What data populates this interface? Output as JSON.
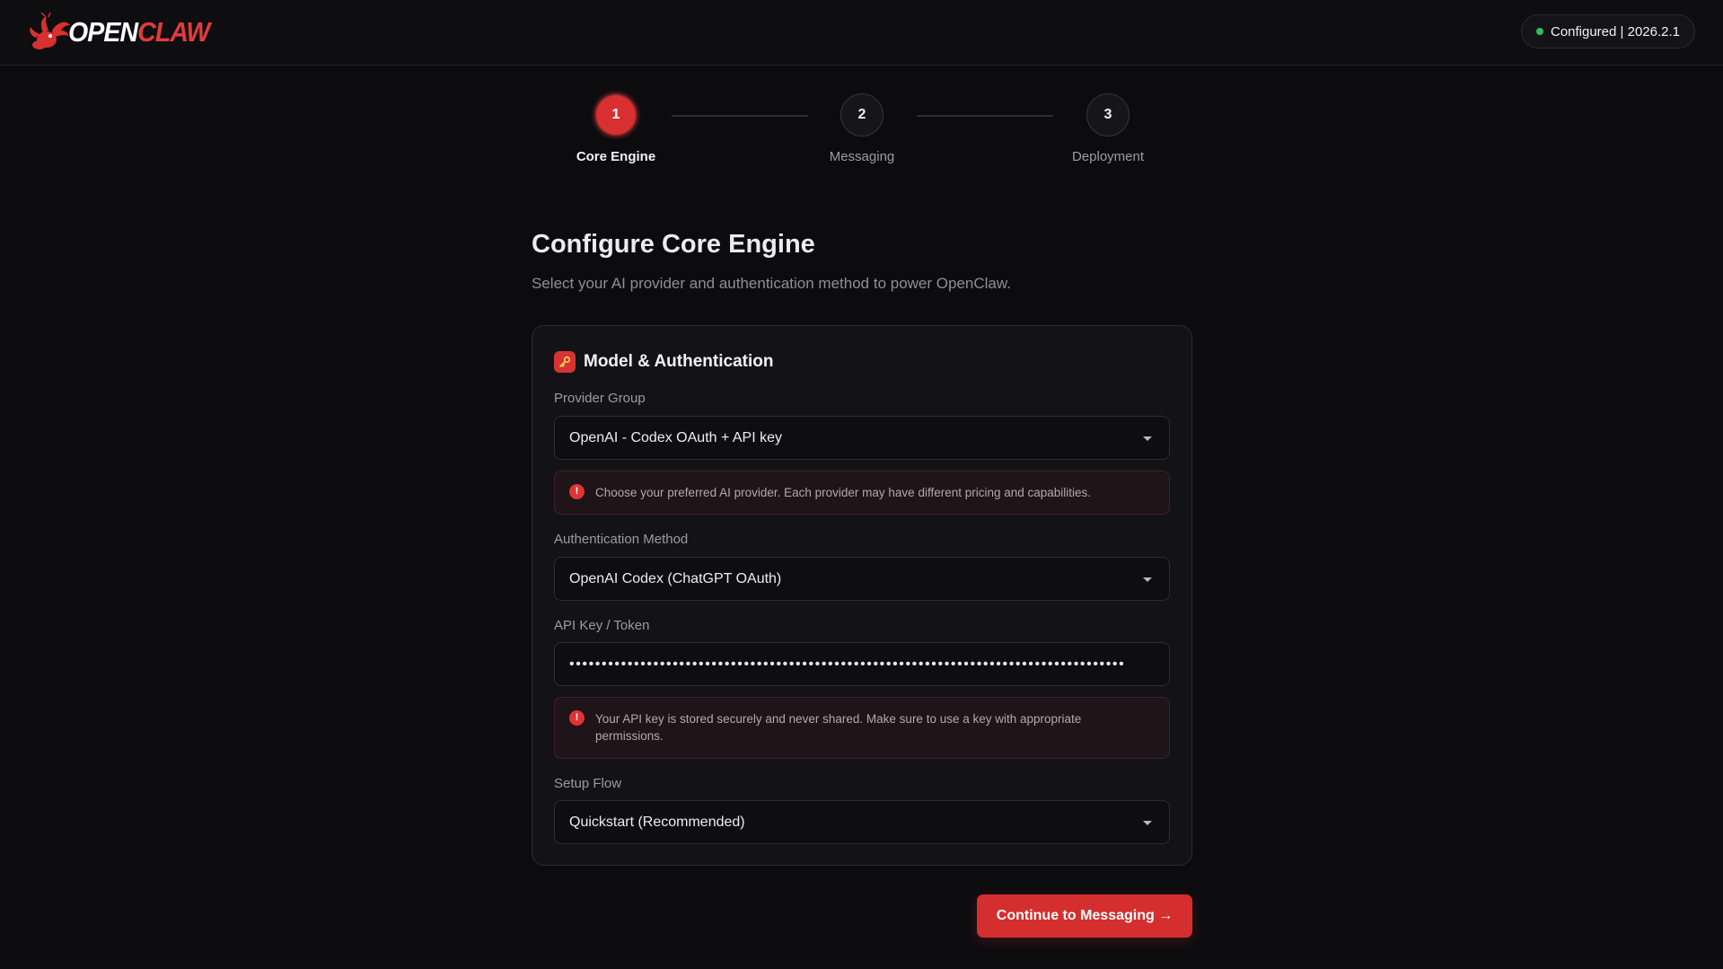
{
  "header": {
    "logo_open": "OPEN",
    "logo_claw": "CLAW",
    "status_text": "Configured | 2026.2.1",
    "status_color": "#2fbf5a"
  },
  "stepper": {
    "steps": [
      {
        "number": "1",
        "label": "Core Engine",
        "active": true
      },
      {
        "number": "2",
        "label": "Messaging",
        "active": false
      },
      {
        "number": "3",
        "label": "Deployment",
        "active": false
      }
    ]
  },
  "main": {
    "title": "Configure Core Engine",
    "subtitle": "Select your AI provider and authentication method to power OpenClaw."
  },
  "card": {
    "title": "Model & Authentication",
    "icon": "key-icon",
    "provider_group": {
      "label": "Provider Group",
      "value": "OpenAI - Codex OAuth + API key"
    },
    "provider_notice": "Choose your preferred AI provider. Each provider may have different pricing and capabilities.",
    "auth_method": {
      "label": "Authentication Method",
      "value": "OpenAI Codex (ChatGPT OAuth)"
    },
    "api_key": {
      "label": "API Key / Token",
      "value": "••••••••••••••••••••••••••••••••••••••••••••••••••••••••••••••••••••••••••••••••••••••"
    },
    "api_notice": "Your API key is stored securely and never shared. Make sure to use a key with appropriate permissions.",
    "setup_flow": {
      "label": "Setup Flow",
      "value": "Quickstart (Recommended)"
    },
    "notice_icon_glyph": "!"
  },
  "actions": {
    "continue_label": "Continue to Messaging →"
  },
  "colors": {
    "accent": "#d83030",
    "background": "#0c0c0f"
  }
}
